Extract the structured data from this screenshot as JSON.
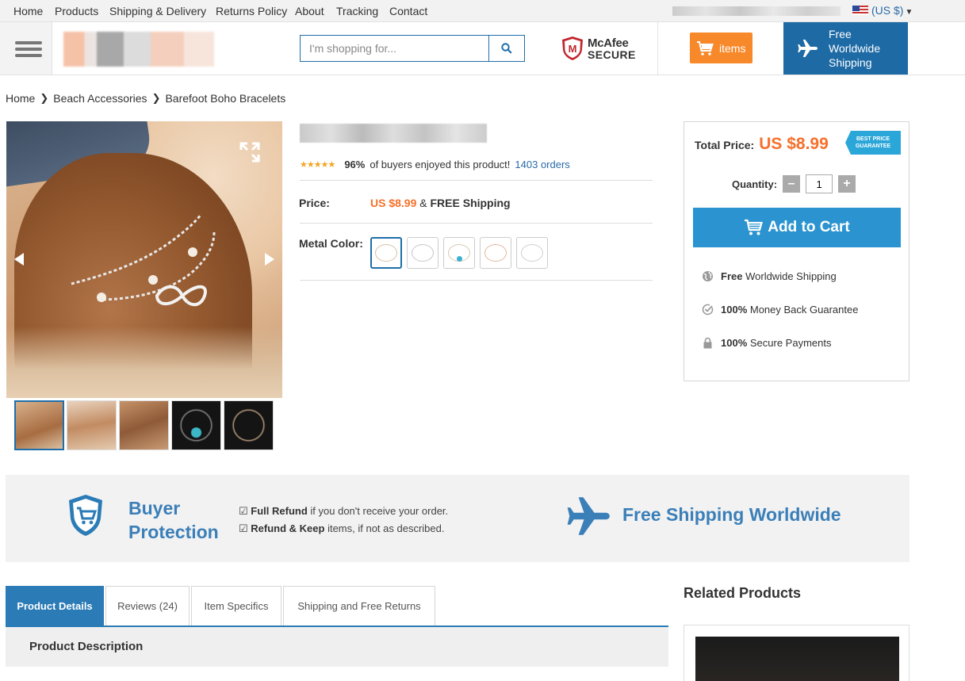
{
  "topnav": {
    "links": [
      "Home",
      "Products",
      "Shipping & Delivery",
      "Returns Policy",
      "About",
      "Tracking",
      "Contact"
    ],
    "currency": "(US $)"
  },
  "header": {
    "search_placeholder": "I'm shopping for...",
    "mcafee_line1": "McAfee",
    "mcafee_line2": "SECURE",
    "cart_label": "items",
    "shipping_text": "Free Worldwide Shipping"
  },
  "breadcrumb": [
    "Home",
    "Beach Accessories",
    "Barefoot Boho Bracelets"
  ],
  "product": {
    "rating_stars": 4.5,
    "rating_percent": "96%",
    "rating_text": "of buyers enjoyed this product!",
    "orders": "1403 orders",
    "price_label": "Price:",
    "price_value": "US $8.99",
    "price_suffix_amp": "&",
    "price_suffix": "FREE Shipping",
    "metal_label": "Metal Color:",
    "thumbnail_count": 5,
    "swatch_count": 5
  },
  "buybox": {
    "total_label": "Total Price:",
    "total_value": "US $8.99",
    "badge_line1": "BEST PRICE",
    "badge_line2": "GUARANTEE",
    "quantity_label": "Quantity:",
    "quantity_value": "1",
    "add_to_cart": "Add to Cart",
    "features": [
      {
        "bold": "Free",
        "text": "Worldwide Shipping",
        "icon": "globe-icon"
      },
      {
        "bold": "100%",
        "text": "Money Back Guarantee",
        "icon": "check-circle-icon"
      },
      {
        "bold": "100%",
        "text": "Secure Payments",
        "icon": "lock-icon"
      }
    ]
  },
  "protection": {
    "title_line1": "Buyer",
    "title_line2": "Protection",
    "items": [
      {
        "bold": "Full Refund",
        "text": "if you don't receive your order."
      },
      {
        "bold": "Refund & Keep",
        "text": "items, if not as described."
      }
    ],
    "shipping_banner": "Free Shipping Worldwide"
  },
  "tabs": [
    "Product Details",
    "Reviews (24)",
    "Item Specifics",
    "Shipping and Free Returns"
  ],
  "product_description_heading": "Product Description",
  "related_heading": "Related Products",
  "colors": {
    "brand_blue": "#1d6aa5",
    "accent_orange": "#f7702b",
    "cart_orange": "#f7892b",
    "add_cart_blue": "#2a93d0"
  }
}
